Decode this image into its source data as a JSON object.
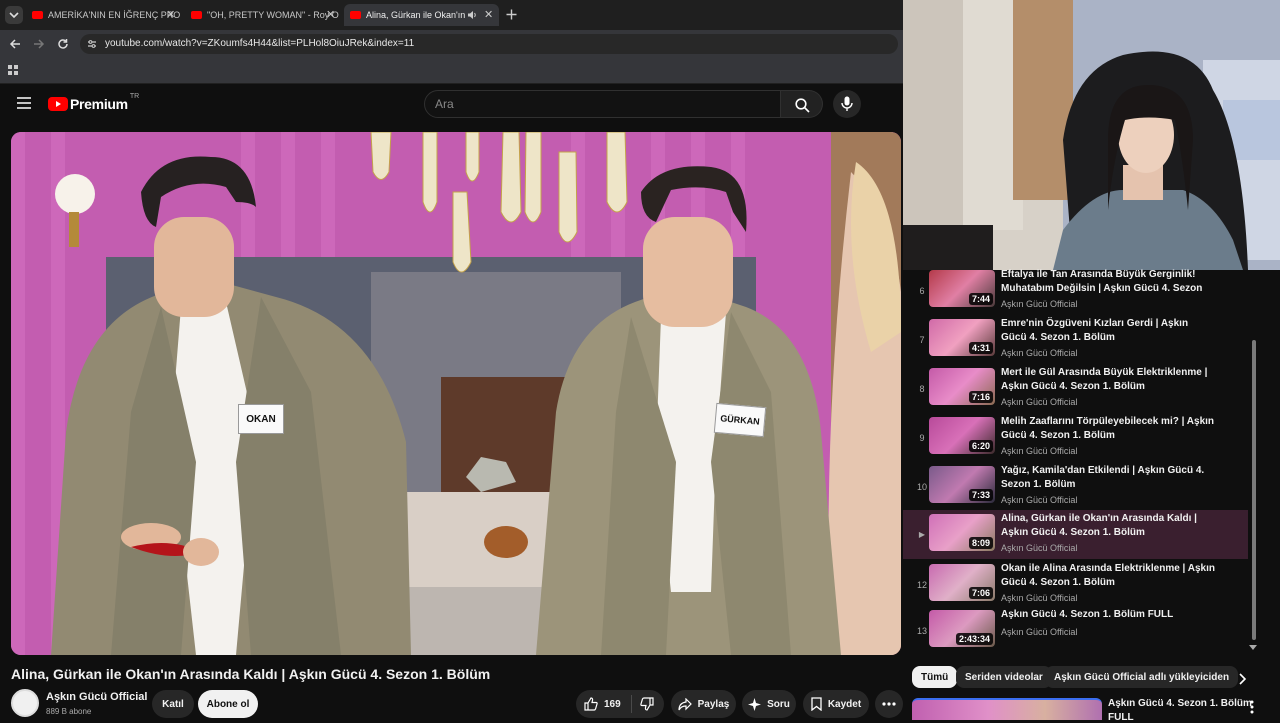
{
  "browser": {
    "tabs": [
      {
        "label": "AMERİKA'NIN EN İĞRENÇ PRO"
      },
      {
        "label": "\"OH, PRETTY WOMAN\" - Roy O"
      },
      {
        "label": "Alina, Gürkan ile Okan'ın Ar"
      }
    ],
    "url": "youtube.com/watch?v=ZKoumfs4H44&list=PLHol8OiuJRek&index=11",
    "new_tab_icon": "plus-icon"
  },
  "youtube": {
    "logo_text": "Premium",
    "logo_superscript": "TR",
    "search_placeholder": "Ara",
    "brand_color": "#ff0000"
  },
  "video": {
    "name_tag_left": "OKAN",
    "name_tag_right": "GÜRKAN",
    "title": "Alina, Gürkan ile Okan'ın Arasında Kaldı | Aşkın Gücü 4. Sezon 1. Bölüm",
    "channel_name": "Aşkın Gücü Official",
    "subscribers": "889 B abone",
    "join_label": "Katıl",
    "subscribe_label": "Abone ol",
    "likes": "169",
    "share_label": "Paylaş",
    "ask_label": "Soru",
    "save_label": "Kaydet"
  },
  "playlist": {
    "items": [
      {
        "index": "6",
        "title": "Eftalya ile Tan Arasında Büyük Gerginlik! Muhatabım Değilsin | Aşkın Gücü 4. Sezon 1....",
        "channel": "Aşkın Gücü Official",
        "duration": "7:44",
        "active": false
      },
      {
        "index": "7",
        "title": "Emre'nin Özgüveni Kızları Gerdi | Aşkın Gücü 4. Sezon 1. Bölüm",
        "channel": "Aşkın Gücü Official",
        "duration": "4:31",
        "active": false
      },
      {
        "index": "8",
        "title": "Mert ile Gül Arasında Büyük Elektriklenme | Aşkın Gücü 4. Sezon 1. Bölüm",
        "channel": "Aşkın Gücü Official",
        "duration": "7:16",
        "active": false
      },
      {
        "index": "9",
        "title": "Melih Zaaflarını Törpüleyebilecek mi? | Aşkın Gücü 4. Sezon 1. Bölüm",
        "channel": "Aşkın Gücü Official",
        "duration": "6:20",
        "active": false
      },
      {
        "index": "10",
        "title": "Yağız, Kamila'dan Etkilendi | Aşkın Gücü 4. Sezon 1. Bölüm",
        "channel": "Aşkın Gücü Official",
        "duration": "7:33",
        "active": false
      },
      {
        "index": "▶",
        "title": "Alina, Gürkan ile Okan'ın Arasında Kaldı | Aşkın Gücü 4. Sezon 1. Bölüm",
        "channel": "Aşkın Gücü Official",
        "duration": "8:09",
        "active": true
      },
      {
        "index": "12",
        "title": "Okan ile Alina Arasında Elektriklenme | Aşkın Gücü 4. Sezon 1. Bölüm",
        "channel": "Aşkın Gücü Official",
        "duration": "7:06",
        "active": false
      },
      {
        "index": "13",
        "title": "Aşkın Gücü 4. Sezon 1. Bölüm FULL",
        "channel": "Aşkın Gücü Official",
        "duration": "2:43:34",
        "active": false
      }
    ]
  },
  "chips": [
    "Tümü",
    "Seriden videolar",
    "Aşkın Gücü Official adlı yükleyiciden"
  ],
  "recommendation": {
    "title_line1": "Aşkın Gücü 4. Sezon 1. Bölüm",
    "title_line2": "FULL"
  }
}
